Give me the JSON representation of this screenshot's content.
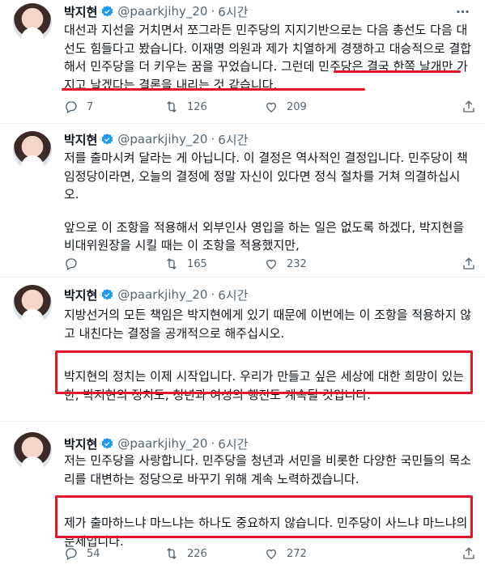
{
  "tweets": [
    {
      "author": "박지현",
      "handle": "@paarkjihy_20",
      "time": "6시간",
      "paragraphs": [
        "대선과 지선을 거치면서 쪼그라든 민주당의 지지기반으로는 다음 총선도 다음 대선도 힘들다고 봤습니다. 이재명 의원과 제가 치열하게 경쟁하고 대승적으로 결합해서 민주당을 더 키우는 꿈을 꾸었습니다. 그런데 민주당은 결국 한쪽 날개만 가지고 날겠다는 결론을 내리는 것 같습니다."
      ],
      "replies": "7",
      "retweets": "126",
      "likes": "209"
    },
    {
      "author": "박지현",
      "handle": "@paarkjihy_20",
      "time": "6시간",
      "paragraphs": [
        "저를 출마시켜 달라는 게 아닙니다. 이 결정은 역사적인 결정입니다. 민주당이 책임정당이라면, 오늘의 결정에 정말 자신이 있다면 정식 절차를 거쳐 의결하십시오.",
        "앞으로 이 조항을 적용해서 외부인사 영입을 하는 일은 없도록 하겠다, 박지현을 비대위원장을 시킬 때는 이 조항을 적용했지만,"
      ],
      "replies": "",
      "retweets": "165",
      "likes": "232"
    },
    {
      "author": "박지현",
      "handle": "@paarkjihy_20",
      "time": "6시간",
      "paragraphs": [
        "지방선거의 모든 책임은 박지현에게 있기 때문에 이번에는 이 조항을 적용하지 않고 내친다는 결정을 공개적으로 해주십시오.",
        "박지현의 정치는 이제 시작입니다. 우리가 만들고 싶은 세상에 대한 희망이 있는 한, 박지현의 정치도, 청년과 여성의 행진도 계속될 것입니다."
      ],
      "replies": "",
      "retweets": "",
      "likes": ""
    },
    {
      "author": "박지현",
      "handle": "@paarkjihy_20",
      "time": "6시간",
      "paragraphs": [
        "저는 민주당을 사랑합니다. 민주당을 청년과 서민을 비롯한 다양한 국민들의 목소리를 대변하는 정당으로 바꾸기 위해 계속 노력하겠습니다.",
        "제가 출마하느냐 마느냐는 하나도 중요하지 않습니다. 민주당이 사느냐 마느냐의 문제입니다."
      ],
      "replies": "54",
      "retweets": "226",
      "likes": "272"
    }
  ],
  "icons": {
    "verified": "verified-badge-icon",
    "more": "more-icon",
    "reply": "reply-icon",
    "retweet": "retweet-icon",
    "like": "heart-icon",
    "share": "share-icon"
  },
  "colors": {
    "verified": "#1d9bf0",
    "highlight": "#e3142b",
    "secondary_text": "#536471"
  }
}
